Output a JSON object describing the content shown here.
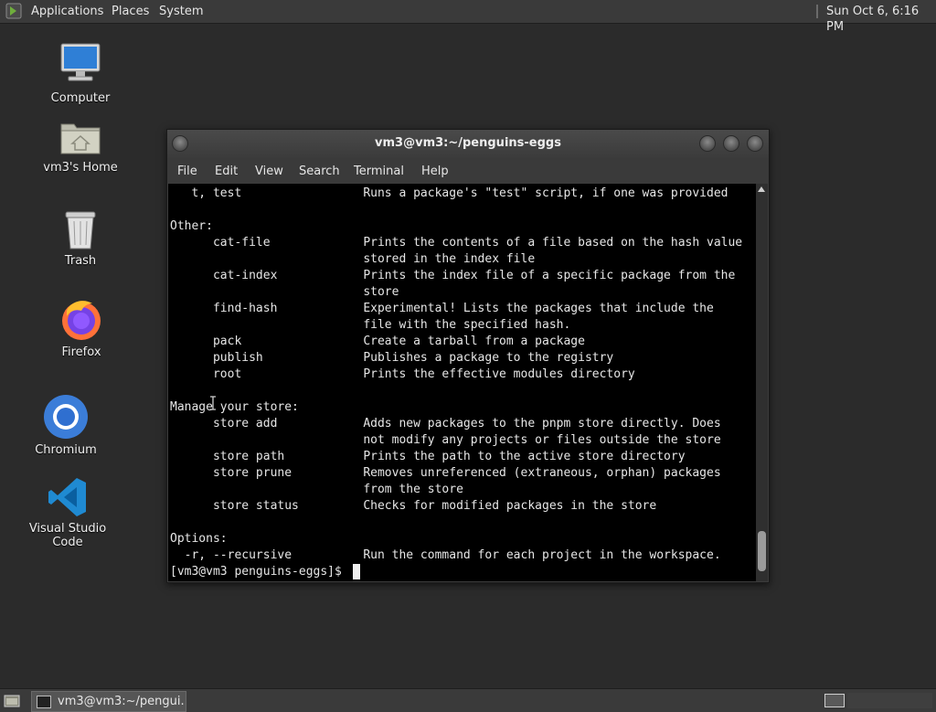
{
  "top_panel": {
    "menus": [
      "Applications",
      "Places",
      "System"
    ],
    "clock": "Sun Oct  6,  6:16 PM"
  },
  "desktop": {
    "icons": [
      {
        "label": "Computer",
        "icon": "computer-icon"
      },
      {
        "label": "vm3's Home",
        "icon": "home-folder-icon"
      },
      {
        "label": "Trash",
        "icon": "trash-icon"
      },
      {
        "label": "Firefox",
        "icon": "firefox-icon"
      },
      {
        "label": "Chromium",
        "icon": "chromium-icon"
      },
      {
        "label": "Visual Studio Code",
        "icon": "vscode-icon"
      }
    ]
  },
  "terminal": {
    "title": "vm3@vm3:~/penguins-eggs",
    "menu": [
      "File",
      "Edit",
      "View",
      "Search",
      "Terminal",
      "Help"
    ],
    "lines": [
      "   t, test                 Runs a package's \"test\" script, if one was provided",
      "",
      "Other:",
      "      cat-file             Prints the contents of a file based on the hash value",
      "                           stored in the index file",
      "      cat-index            Prints the index file of a specific package from the",
      "                           store",
      "      find-hash            Experimental! Lists the packages that include the",
      "                           file with the specified hash.",
      "      pack                 Create a tarball from a package",
      "      publish              Publishes a package to the registry",
      "      root                 Prints the effective modules directory",
      "",
      "Manage your store:",
      "      store add            Adds new packages to the pnpm store directly. Does",
      "                           not modify any projects or files outside the store",
      "      store path           Prints the path to the active store directory",
      "      store prune          Removes unreferenced (extraneous, orphan) packages",
      "                           from the store",
      "      store status         Checks for modified packages in the store",
      "",
      "Options:",
      "  -r, --recursive          Run the command for each project in the workspace.",
      "[vm3@vm3 penguins-eggs]$ "
    ]
  },
  "taskbar": {
    "window_button": "vm3@vm3:~/pengui..."
  },
  "colors": {
    "panel": "#3a3a3a",
    "desktop": "#2b2b2b",
    "terminal_bg": "#000000",
    "terminal_fg": "#e6e6e6"
  }
}
